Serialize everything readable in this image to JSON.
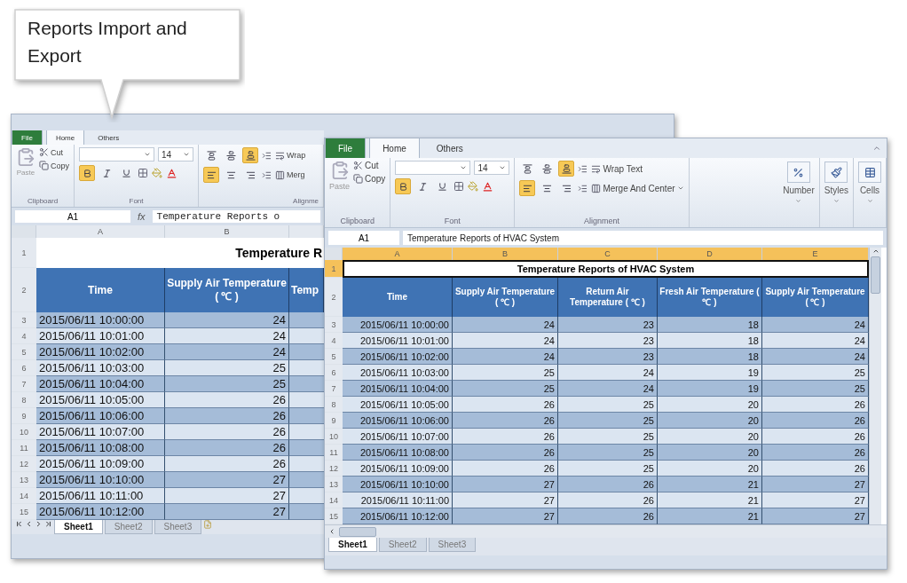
{
  "callout": {
    "text": "Reports Import and Export"
  },
  "back_window": {
    "tabs": [
      {
        "label": "File",
        "kind": "file",
        "selected": false
      },
      {
        "label": "Home",
        "kind": "tab",
        "selected": true
      },
      {
        "label": "Others",
        "kind": "tab",
        "selected": false
      }
    ],
    "clipboard": {
      "paste": "Paste",
      "cut": "Cut",
      "copy": "Copy",
      "label": "Clipboard"
    },
    "font": {
      "size": "14",
      "label": "Font",
      "toggles": [
        {
          "kind": "bold",
          "on": true
        },
        {
          "kind": "italic",
          "on": false
        },
        {
          "kind": "underline",
          "on": false
        }
      ]
    },
    "alignment": {
      "wrap": "Wrap",
      "merge": "Merg",
      "label": "Alignme",
      "top_row": [
        {
          "kind": "top",
          "on": false
        },
        {
          "kind": "middle",
          "on": false
        },
        {
          "kind": "bottom",
          "on": true
        }
      ],
      "bottom_row": [
        {
          "kind": "left",
          "on": true
        },
        {
          "kind": "center",
          "on": false
        },
        {
          "kind": "right",
          "on": false
        }
      ]
    },
    "name_box": "A1",
    "fx": "fx",
    "formula": "Temperature Reports o",
    "columns": [
      {
        "label": "A",
        "selected": false
      },
      {
        "label": "B",
        "selected": false
      }
    ],
    "title_row": {
      "num": "1",
      "selected": false,
      "text": "Temperature R"
    },
    "header_row": {
      "num": "2",
      "cells": [
        "Time",
        "Supply Air Temperature ( ℃ )",
        "Temp"
      ]
    },
    "rows": [
      {
        "num": "3",
        "cells": [
          "2015/06/11 10:00:00",
          "24"
        ]
      },
      {
        "num": "4",
        "cells": [
          "2015/06/11 10:01:00",
          "24"
        ]
      },
      {
        "num": "5",
        "cells": [
          "2015/06/11 10:02:00",
          "24"
        ]
      },
      {
        "num": "6",
        "cells": [
          "2015/06/11 10:03:00",
          "25"
        ]
      },
      {
        "num": "7",
        "cells": [
          "2015/06/11 10:04:00",
          "25"
        ]
      },
      {
        "num": "8",
        "cells": [
          "2015/06/11 10:05:00",
          "26"
        ]
      },
      {
        "num": "9",
        "cells": [
          "2015/06/11 10:06:00",
          "26"
        ]
      },
      {
        "num": "10",
        "cells": [
          "2015/06/11 10:07:00",
          "26"
        ]
      },
      {
        "num": "11",
        "cells": [
          "2015/06/11 10:08:00",
          "26"
        ]
      },
      {
        "num": "12",
        "cells": [
          "2015/06/11 10:09:00",
          "26"
        ]
      },
      {
        "num": "13",
        "cells": [
          "2015/06/11 10:10:00",
          "27"
        ]
      },
      {
        "num": "14",
        "cells": [
          "2015/06/11 10:11:00",
          "27"
        ]
      },
      {
        "num": "15",
        "cells": [
          "2015/06/11 10:12:00",
          "27"
        ]
      }
    ],
    "sheets": [
      {
        "label": "Sheet1",
        "selected": true
      },
      {
        "label": "Sheet2",
        "selected": false
      },
      {
        "label": "Sheet3",
        "selected": false
      }
    ]
  },
  "front_window": {
    "tabs": [
      {
        "label": "File",
        "kind": "file",
        "selected": false
      },
      {
        "label": "Home",
        "kind": "tab",
        "selected": true
      },
      {
        "label": "Others",
        "kind": "tab",
        "selected": false
      }
    ],
    "clipboard": {
      "paste": "Paste",
      "cut": "Cut",
      "copy": "Copy",
      "label": "Clipboard"
    },
    "font": {
      "size": "14",
      "label": "Font",
      "toggles": [
        {
          "kind": "bold",
          "on": true
        },
        {
          "kind": "italic",
          "on": false
        },
        {
          "kind": "underline",
          "on": false
        }
      ]
    },
    "alignment": {
      "wrap": "Wrap Text",
      "merge": "Merge And Center",
      "label": "Alignment",
      "top_row": [
        {
          "kind": "top",
          "on": false
        },
        {
          "kind": "middle",
          "on": false
        },
        {
          "kind": "bottom",
          "on": true
        }
      ],
      "bottom_row": [
        {
          "kind": "left",
          "on": true
        },
        {
          "kind": "center",
          "on": false
        },
        {
          "kind": "right",
          "on": false
        }
      ]
    },
    "extra_groups": [
      {
        "label": "Number",
        "kind": "number"
      },
      {
        "label": "Styles",
        "kind": "styles"
      },
      {
        "label": "Cells",
        "kind": "cells"
      }
    ],
    "name_box": "A1",
    "formula": "Temperature Reports of HVAC System",
    "columns": [
      {
        "label": "A",
        "selected": true
      },
      {
        "label": "B",
        "selected": true
      },
      {
        "label": "C",
        "selected": true
      },
      {
        "label": "D",
        "selected": true
      },
      {
        "label": "E",
        "selected": true
      }
    ],
    "title_row": {
      "num": "1",
      "selected": true,
      "text": "Temperature Reports of HVAC System"
    },
    "header_row": {
      "num": "2",
      "cells": [
        "Time",
        "Supply Air Temperature ( ℃ )",
        "Return Air Temperature ( ℃ )",
        "Fresh Air Temperature ( ℃ )",
        "Supply Air Temperature ( ℃ )"
      ]
    },
    "rows": [
      {
        "num": "3",
        "cells": [
          "2015/06/11 10:00:00",
          "24",
          "23",
          "18",
          "24"
        ]
      },
      {
        "num": "4",
        "cells": [
          "2015/06/11 10:01:00",
          "24",
          "23",
          "18",
          "24"
        ]
      },
      {
        "num": "5",
        "cells": [
          "2015/06/11 10:02:00",
          "24",
          "23",
          "18",
          "24"
        ]
      },
      {
        "num": "6",
        "cells": [
          "2015/06/11 10:03:00",
          "25",
          "24",
          "19",
          "25"
        ]
      },
      {
        "num": "7",
        "cells": [
          "2015/06/11 10:04:00",
          "25",
          "24",
          "19",
          "25"
        ]
      },
      {
        "num": "8",
        "cells": [
          "2015/06/11 10:05:00",
          "26",
          "25",
          "20",
          "26"
        ]
      },
      {
        "num": "9",
        "cells": [
          "2015/06/11 10:06:00",
          "26",
          "25",
          "20",
          "26"
        ]
      },
      {
        "num": "10",
        "cells": [
          "2015/06/11 10:07:00",
          "26",
          "25",
          "20",
          "26"
        ]
      },
      {
        "num": "11",
        "cells": [
          "2015/06/11 10:08:00",
          "26",
          "25",
          "20",
          "26"
        ]
      },
      {
        "num": "12",
        "cells": [
          "2015/06/11 10:09:00",
          "26",
          "25",
          "20",
          "26"
        ]
      },
      {
        "num": "13",
        "cells": [
          "2015/06/11 10:10:00",
          "27",
          "26",
          "21",
          "27"
        ]
      },
      {
        "num": "14",
        "cells": [
          "2015/06/11 10:11:00",
          "27",
          "26",
          "21",
          "27"
        ]
      },
      {
        "num": "15",
        "cells": [
          "2015/06/11 10:12:00",
          "27",
          "26",
          "21",
          "27"
        ]
      }
    ],
    "sheets": [
      {
        "label": "Sheet1",
        "selected": true
      },
      {
        "label": "Sheet2",
        "selected": false
      },
      {
        "label": "Sheet3",
        "selected": false
      }
    ]
  }
}
